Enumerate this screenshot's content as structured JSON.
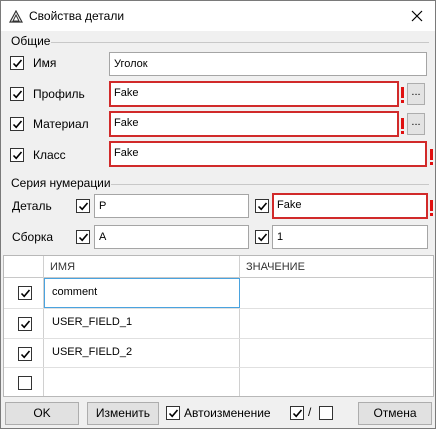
{
  "window": {
    "title": "Свойства детали",
    "close_icon": "close-icon"
  },
  "general": {
    "group_label": "Общие",
    "fields": [
      {
        "label": "Имя",
        "checked": true,
        "value": "Уголок",
        "error": false
      },
      {
        "label": "Профиль",
        "checked": true,
        "value": "Fake",
        "error": true,
        "browse": "..."
      },
      {
        "label": "Материал",
        "checked": true,
        "value": "Fake",
        "error": true,
        "browse": "..."
      },
      {
        "label": "Класс",
        "checked": true,
        "value": "Fake",
        "error": true
      }
    ]
  },
  "numbering": {
    "group_label": "Серия нумерации",
    "rows": [
      {
        "label": "Деталь",
        "prefix_checked": true,
        "prefix": "P",
        "start_checked": true,
        "start": "Fake",
        "start_error": true
      },
      {
        "label": "Сборка",
        "prefix_checked": true,
        "prefix": "A",
        "start_checked": true,
        "start": "1",
        "start_error": false
      }
    ]
  },
  "table": {
    "columns": [
      "ИМЯ",
      "ЗНАЧЕНИЕ"
    ],
    "rows": [
      {
        "checked": true,
        "name": "comment",
        "value": "",
        "selected": true
      },
      {
        "checked": true,
        "name": "USER_FIELD_1",
        "value": ""
      },
      {
        "checked": true,
        "name": "USER_FIELD_2",
        "value": ""
      },
      {
        "checked": false,
        "name": "",
        "value": ""
      }
    ]
  },
  "footer": {
    "ok": "OK",
    "change": "Изменить",
    "auto_label": "Автоизменение",
    "auto_checked": true,
    "toggle_sep": "/",
    "cancel": "Отмена"
  },
  "colors": {
    "error_border": "#d12a2a",
    "error_mark": "#e01010",
    "selection": "#4aa3df"
  }
}
